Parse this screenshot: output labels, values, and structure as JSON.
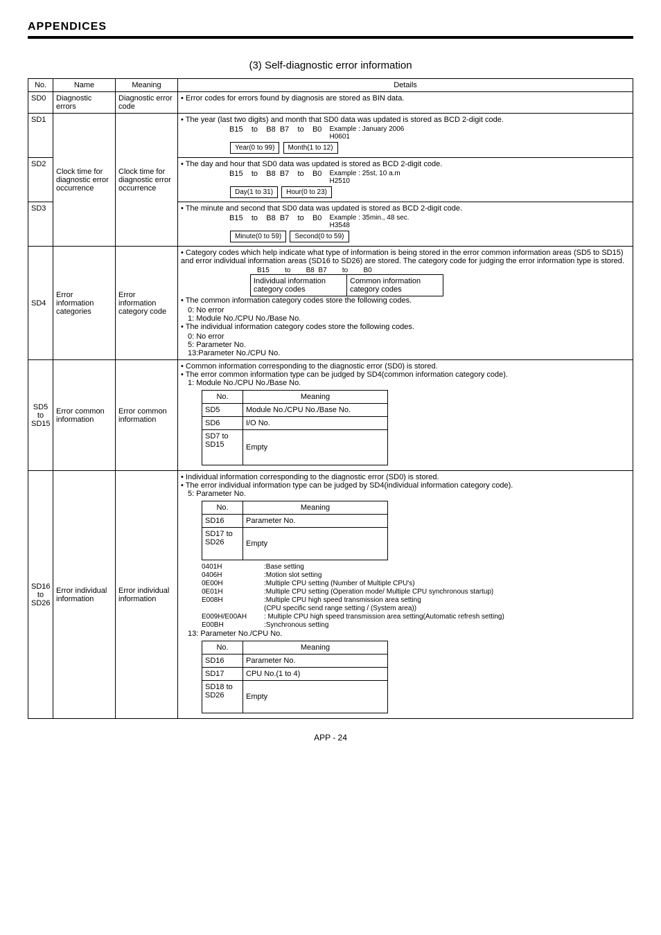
{
  "header": "APPENDICES",
  "section_title": "(3)  Self-diagnostic error information",
  "columns": {
    "no": "No.",
    "name": "Name",
    "meaning": "Meaning",
    "details": "Details"
  },
  "rows": {
    "sd0": {
      "no": "SD0",
      "name": "Diagnostic errors",
      "meaning": "Diagnostic error code",
      "details": "• Error codes for errors found by diagnosis are stored as BIN data."
    },
    "sd1": {
      "no": "SD1",
      "line1": "• The year (last two digits) and month that SD0 data was updated is stored as BCD 2-digit code.",
      "bits": {
        "b15": "B15",
        "to1": "to",
        "b8": "B8",
        "b7": "B7",
        "to2": "to",
        "b0": "B0"
      },
      "box1": "Year(0 to 99)",
      "box2": "Month(1 to 12)",
      "example1": "Example : January 2006",
      "example2": "H0601"
    },
    "sd2": {
      "no": "SD2",
      "name": "Clock time for diagnostic error occurrence",
      "meaning": "Clock time for diagnostic error occurrence",
      "line1": "• The day and hour that SD0 data was updated is stored as BCD 2-digit code.",
      "box1": "Day(1 to 31)",
      "box2": "Hour(0 to 23)",
      "example1": "Example : 25st, 10 a.m",
      "example2": "H2510"
    },
    "sd3": {
      "no": "SD3",
      "line1": "• The minute and second that SD0 data was updated is stored as BCD 2-digit code.",
      "box1": "Minute(0 to 59)",
      "box2": "Second(0 to 59)",
      "example1": "Example : 35min., 48 sec.",
      "example2": "H3548"
    },
    "sd4": {
      "no": "SD4",
      "name": "Error information categories",
      "meaning": "Error information category code",
      "line1": "• Category codes which help indicate what type of information is being stored in the error common information areas (SD5 to SD15) and error individual information areas (SD16 to SD26) are stored. The category code for judging the error information type is stored.",
      "bits": {
        "b15": "B15",
        "to1": "to",
        "b8": "B8",
        "b7": "B7",
        "to2": "to",
        "b0": "B0"
      },
      "cat1": "Individual information category codes",
      "cat2": "Common information category codes",
      "line2": "• The common information category codes store the following codes.",
      "c0": "0: No error",
      "c1": "1: Module No./CPU No./Base No.",
      "line3": "• The individual information category codes store the following codes.",
      "i0": "0: No error",
      "i5": "5: Parameter No.",
      "i13": "13:Parameter No./CPU No."
    },
    "sd5": {
      "no": "SD5 to SD15",
      "name": "Error common information",
      "meaning": "Error common information",
      "line1": "• Common information corresponding to the diagnostic error (SD0) is stored.",
      "line2": "• The error common information type can be judged by SD4(common information category code).",
      "line3": "1: Module No./CPU No./Base No.",
      "th1": "No.",
      "th2": "Meaning",
      "r1a": "SD5",
      "r1b": "Module No./CPU No./Base No.",
      "r2a": "SD6",
      "r2b": "I/O No.",
      "r3a": "SD7 to SD15",
      "r3b": "Empty"
    },
    "sd16": {
      "no": "SD16 to SD26",
      "name": "Error individual information",
      "meaning": "Error individual information",
      "line1": "• Individual information corresponding to the diagnostic error (SD0) is stored.",
      "line2": "• The error individual information type can be judged by SD4(individual information category code).",
      "line3": "5: Parameter No.",
      "t1": {
        "th1": "No.",
        "th2": "Meaning",
        "r1a": "SD16",
        "r1b": "Parameter No.",
        "r2a": "SD17 to SD26",
        "r2b": "Empty"
      },
      "codes": {
        "c1": {
          "k": "0401H",
          "v": ":Base setting"
        },
        "c2": {
          "k": "0406H",
          "v": ":Motion slot setting"
        },
        "c3": {
          "k": "0E00H",
          "v": ":Multiple CPU setting (Number of Multiple CPU's)"
        },
        "c4": {
          "k": "0E01H",
          "v": ":Multiple CPU setting (Operation mode/ Multiple CPU synchronous startup)"
        },
        "c5": {
          "k": "E008H",
          "v": ":Multiple CPU high speed transmission area setting"
        },
        "c5b": {
          "k": "",
          "v": "(CPU specific send range setting / (System area))"
        },
        "c6": {
          "k": "E009H/E00AH",
          "v": ": Multiple CPU high speed transmission area setting(Automatic refresh setting)"
        },
        "c7": {
          "k": "E00BH",
          "v": ":Synchronous setting"
        }
      },
      "line4": "13: Parameter No./CPU No.",
      "t2": {
        "th1": "No.",
        "th2": "Meaning",
        "r1a": "SD16",
        "r1b": "Parameter No.",
        "r2a": "SD17",
        "r2b": "CPU No.(1 to 4)",
        "r3a": "SD18 to SD26",
        "r3b": "Empty"
      }
    }
  },
  "footer": "APP - 24"
}
